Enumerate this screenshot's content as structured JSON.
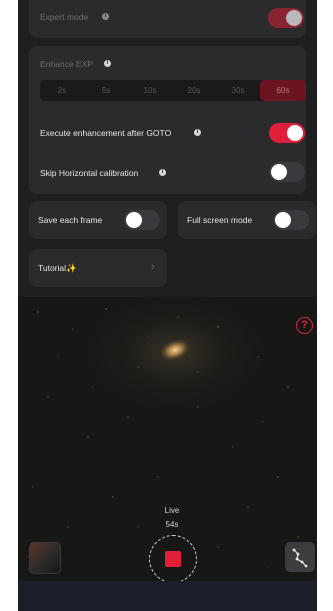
{
  "settings": {
    "expert_mode": {
      "label": "Expert mode",
      "on": true
    },
    "enhance_exp": {
      "label": "Enhance EXP",
      "options": [
        "2s",
        "5s",
        "10s",
        "20s",
        "30s",
        "60s"
      ],
      "selected": "60s"
    },
    "execute_after_goto": {
      "label": "Execute enhancement after GOTO",
      "on": true
    },
    "skip_horizontal": {
      "label": "Skip Horizontal calibration",
      "on": false
    },
    "save_each_frame": {
      "label": "Save each frame",
      "on": false
    },
    "full_screen": {
      "label": "Full screen mode",
      "on": false
    },
    "tutorial": {
      "label": "Tutorial✨"
    }
  },
  "live": {
    "mode_label": "Live",
    "elapsed": "54s"
  },
  "icons": {
    "info": "info-circle-icon",
    "help": "question-circle-icon",
    "chevron": "chevron-right-icon",
    "stop": "stop-square-icon",
    "constellation": "constellation-icon"
  },
  "colors": {
    "accent": "#e01f3a",
    "panel": "#2b2b2e",
    "background": "#1f1f22"
  }
}
